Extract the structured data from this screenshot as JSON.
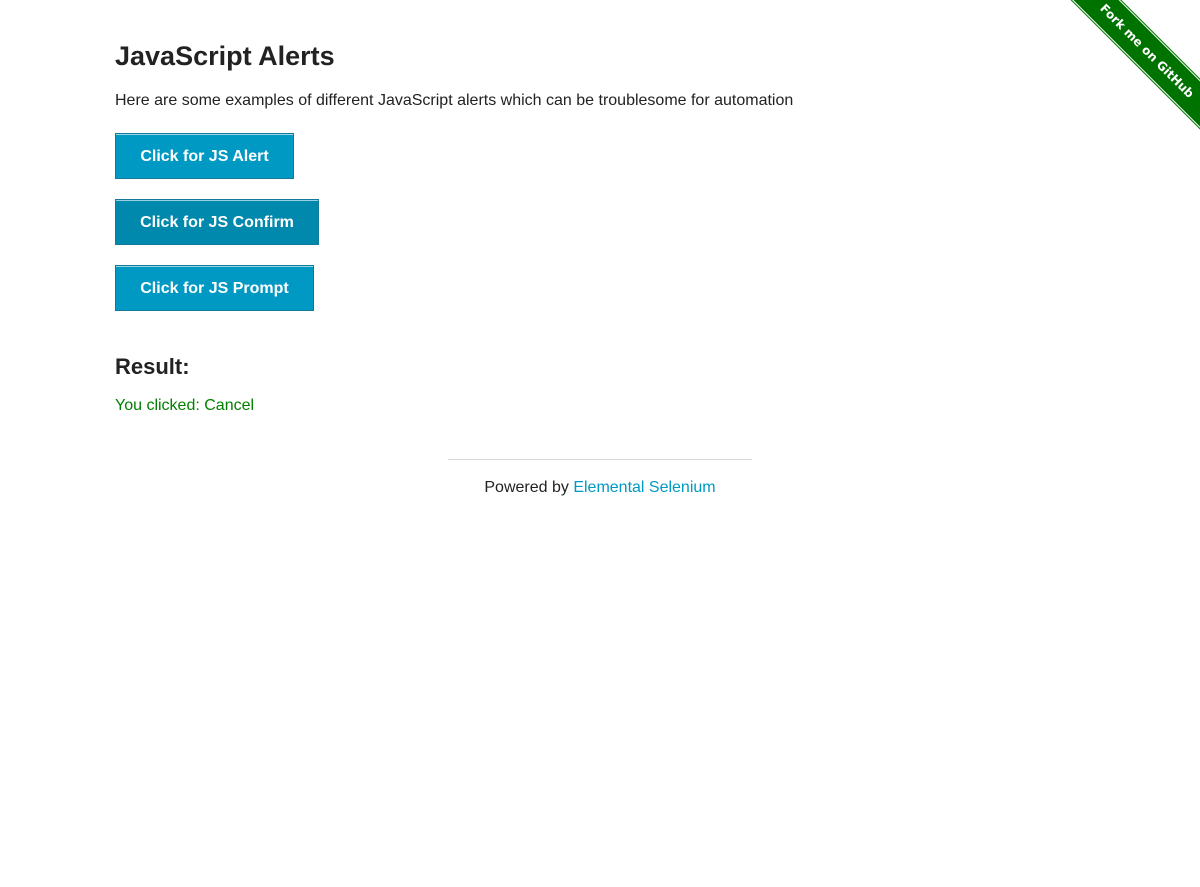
{
  "ribbon": {
    "label": "Fork me on GitHub",
    "color": "#007200"
  },
  "main": {
    "title": "JavaScript Alerts",
    "intro": "Here are some examples of different JavaScript alerts which can be troublesome for automation",
    "buttons": [
      {
        "label": "Click for JS Alert"
      },
      {
        "label": "Click for JS Confirm"
      },
      {
        "label": "Click for JS Prompt"
      }
    ],
    "result_heading": "Result:",
    "result_text": "You clicked: Cancel",
    "result_color": "#008000",
    "button_color": "#0099c4"
  },
  "footer": {
    "prefix": "Powered by ",
    "link_label": "Elemental Selenium",
    "link_color": "#0099c4"
  }
}
